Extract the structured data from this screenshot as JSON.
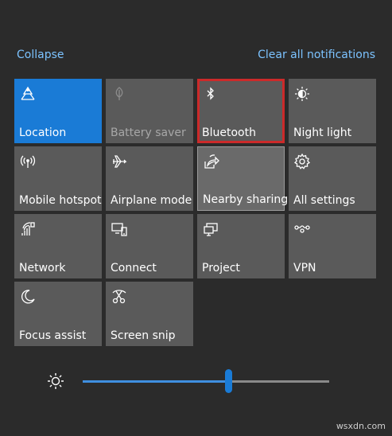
{
  "header": {
    "collapse_label": "Collapse",
    "clear_all_label": "Clear all notifications"
  },
  "tiles": [
    {
      "label": "Location",
      "icon": "location-icon",
      "state": "active"
    },
    {
      "label": "Battery saver",
      "icon": "battery-saver-icon",
      "state": "disabled"
    },
    {
      "label": "Bluetooth",
      "icon": "bluetooth-icon",
      "state": "highlighted"
    },
    {
      "label": "Night light",
      "icon": "night-light-icon",
      "state": "off"
    },
    {
      "label": "Mobile hotspot",
      "icon": "mobile-hotspot-icon",
      "state": "off"
    },
    {
      "label": "Airplane mode",
      "icon": "airplane-icon",
      "state": "off"
    },
    {
      "label": "Nearby sharing",
      "icon": "nearby-sharing-icon",
      "state": "hovered"
    },
    {
      "label": "All settings",
      "icon": "gear-icon",
      "state": "off"
    },
    {
      "label": "Network",
      "icon": "network-icon",
      "state": "off"
    },
    {
      "label": "Connect",
      "icon": "connect-icon",
      "state": "off"
    },
    {
      "label": "Project",
      "icon": "project-icon",
      "state": "off"
    },
    {
      "label": "VPN",
      "icon": "vpn-icon",
      "state": "off"
    },
    {
      "label": "Focus assist",
      "icon": "moon-icon",
      "state": "off"
    },
    {
      "label": "Screen snip",
      "icon": "screen-snip-icon",
      "state": "off"
    }
  ],
  "brightness": {
    "icon": "brightness-icon",
    "level": 0.59
  },
  "colors": {
    "accent": "#1a7bd6",
    "highlight_border": "#cc2a2a",
    "link": "#7cc3ff"
  },
  "watermark": "wsxdn.com"
}
